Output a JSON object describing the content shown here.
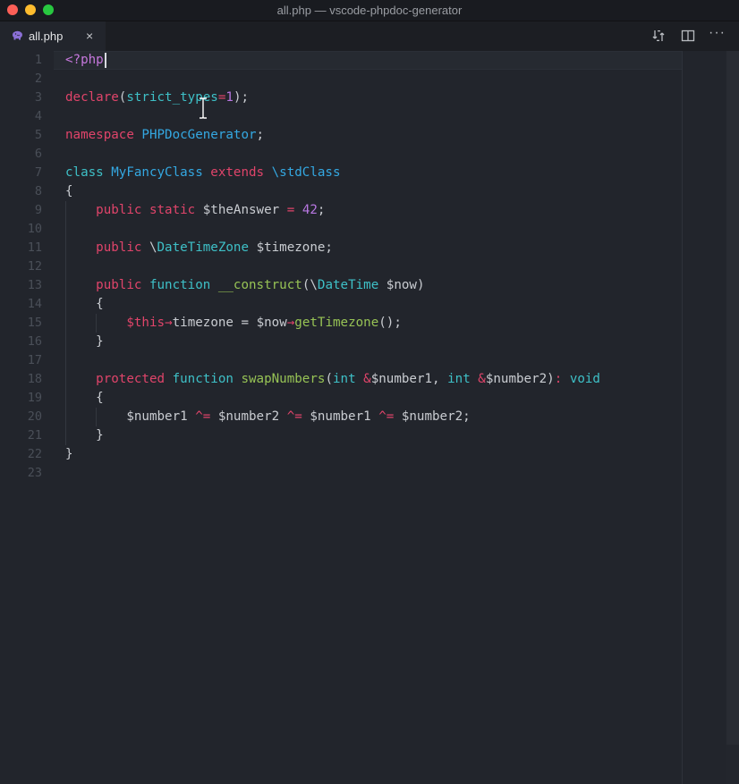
{
  "window": {
    "title": "all.php — vscode-phpdoc-generator"
  },
  "tab": {
    "label": "all.php",
    "icon": "php-elephant-icon",
    "close_glyph": "×"
  },
  "toolbar": {
    "more_glyph": "···"
  },
  "colors": {
    "background": "#22252c",
    "keyword": "#e0446a",
    "type": "#3ec0c7",
    "class_name": "#34a8e2",
    "function_name": "#97c355",
    "number": "#b877e2",
    "tag": "#c678dd"
  },
  "editor": {
    "language": "php",
    "cursor_line": 1,
    "lines": [
      [
        {
          "t": "<?php",
          "c": "k-tag"
        }
      ],
      [],
      [
        {
          "t": "declare",
          "c": "k-red"
        },
        {
          "t": "(",
          "c": "k-plain"
        },
        {
          "t": "strict_types",
          "c": "k-cyan"
        },
        {
          "t": "=",
          "c": "k-op"
        },
        {
          "t": "1",
          "c": "k-purple"
        },
        {
          "t": ");",
          "c": "k-plain"
        }
      ],
      [],
      [
        {
          "t": "namespace ",
          "c": "k-red"
        },
        {
          "t": "PHPDocGenerator",
          "c": "k-blue"
        },
        {
          "t": ";",
          "c": "k-plain"
        }
      ],
      [],
      [
        {
          "t": "class ",
          "c": "k-cyan"
        },
        {
          "t": "MyFancyClass ",
          "c": "k-blue"
        },
        {
          "t": "extends ",
          "c": "k-red"
        },
        {
          "t": "\\stdClass",
          "c": "k-blue"
        }
      ],
      [
        {
          "t": "{",
          "c": "k-plain"
        }
      ],
      [
        {
          "t": "    ",
          "c": "k-plain"
        },
        {
          "t": "public ",
          "c": "k-red"
        },
        {
          "t": "static ",
          "c": "k-red"
        },
        {
          "t": "$theAnswer ",
          "c": "k-var"
        },
        {
          "t": "= ",
          "c": "k-op"
        },
        {
          "t": "42",
          "c": "k-purple"
        },
        {
          "t": ";",
          "c": "k-plain"
        }
      ],
      [],
      [
        {
          "t": "    ",
          "c": "k-plain"
        },
        {
          "t": "public ",
          "c": "k-red"
        },
        {
          "t": "\\",
          "c": "k-plain"
        },
        {
          "t": "DateTimeZone ",
          "c": "k-cyan"
        },
        {
          "t": "$timezone;",
          "c": "k-var"
        }
      ],
      [],
      [
        {
          "t": "    ",
          "c": "k-plain"
        },
        {
          "t": "public ",
          "c": "k-red"
        },
        {
          "t": "function ",
          "c": "k-cyan"
        },
        {
          "t": "__construct",
          "c": "k-green"
        },
        {
          "t": "(\\",
          "c": "k-plain"
        },
        {
          "t": "DateTime ",
          "c": "k-cyan"
        },
        {
          "t": "$now)",
          "c": "k-var"
        }
      ],
      [
        {
          "t": "    {",
          "c": "k-plain"
        }
      ],
      [
        {
          "t": "        ",
          "c": "k-plain"
        },
        {
          "t": "$this",
          "c": "k-this"
        },
        {
          "t": "→",
          "c": "k-op"
        },
        {
          "t": "timezone ",
          "c": "k-var"
        },
        {
          "t": "= ",
          "c": "k-plain"
        },
        {
          "t": "$now",
          "c": "k-var"
        },
        {
          "t": "→",
          "c": "k-op"
        },
        {
          "t": "getTimezone",
          "c": "k-green"
        },
        {
          "t": "();",
          "c": "k-plain"
        }
      ],
      [
        {
          "t": "    }",
          "c": "k-plain"
        }
      ],
      [],
      [
        {
          "t": "    ",
          "c": "k-plain"
        },
        {
          "t": "protected ",
          "c": "k-red"
        },
        {
          "t": "function ",
          "c": "k-cyan"
        },
        {
          "t": "swapNumbers",
          "c": "k-green"
        },
        {
          "t": "(",
          "c": "k-plain"
        },
        {
          "t": "int ",
          "c": "k-cyan"
        },
        {
          "t": "&",
          "c": "k-op"
        },
        {
          "t": "$number1, ",
          "c": "k-var"
        },
        {
          "t": "int ",
          "c": "k-cyan"
        },
        {
          "t": "&",
          "c": "k-op"
        },
        {
          "t": "$number2)",
          "c": "k-var"
        },
        {
          "t": ": ",
          "c": "k-op"
        },
        {
          "t": "void",
          "c": "k-cyan"
        }
      ],
      [
        {
          "t": "    {",
          "c": "k-plain"
        }
      ],
      [
        {
          "t": "        ",
          "c": "k-plain"
        },
        {
          "t": "$number1 ",
          "c": "k-var"
        },
        {
          "t": "^= ",
          "c": "k-op"
        },
        {
          "t": "$number2 ",
          "c": "k-var"
        },
        {
          "t": "^= ",
          "c": "k-op"
        },
        {
          "t": "$number1 ",
          "c": "k-var"
        },
        {
          "t": "^= ",
          "c": "k-op"
        },
        {
          "t": "$number2;",
          "c": "k-var"
        }
      ],
      [
        {
          "t": "    }",
          "c": "k-plain"
        }
      ],
      [
        {
          "t": "}",
          "c": "k-plain"
        }
      ],
      []
    ]
  }
}
